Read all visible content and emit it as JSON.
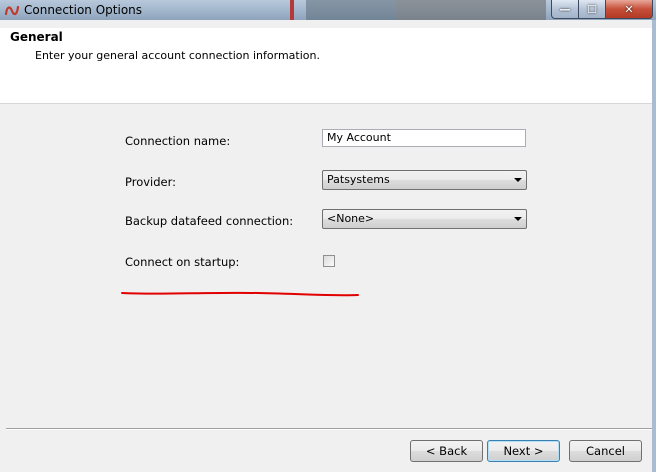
{
  "window": {
    "title": "Connection Options",
    "controls": {
      "minimize": "—",
      "maximize": "☐",
      "close": "✕"
    }
  },
  "header": {
    "title": "General",
    "description": "Enter your general account connection information."
  },
  "form": {
    "connection_name_label": "Connection name:",
    "connection_name_value": "My Account",
    "provider_label": "Provider:",
    "provider_value": "Patsystems",
    "backup_label": "Backup datafeed connection:",
    "backup_value": "<None>",
    "connect_on_startup_label": "Connect on startup:",
    "connect_on_startup_checked": false
  },
  "footer": {
    "back_label": "< Back",
    "next_label": "Next >",
    "cancel_label": "Cancel"
  },
  "colors": {
    "annotation_red": "#e00000",
    "dialog_bg": "#f0f0f0",
    "header_bg": "#ffffff"
  }
}
